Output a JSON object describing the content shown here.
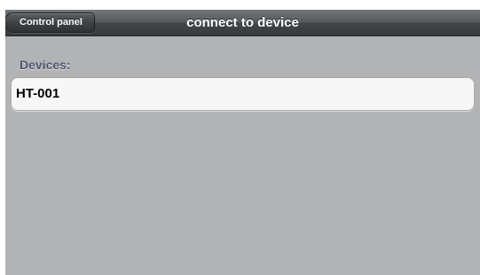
{
  "navbar": {
    "back_label": "Control panel",
    "title": "connect to device"
  },
  "devices": {
    "header": "Devices:",
    "items": [
      {
        "name": "HT-001"
      }
    ]
  }
}
